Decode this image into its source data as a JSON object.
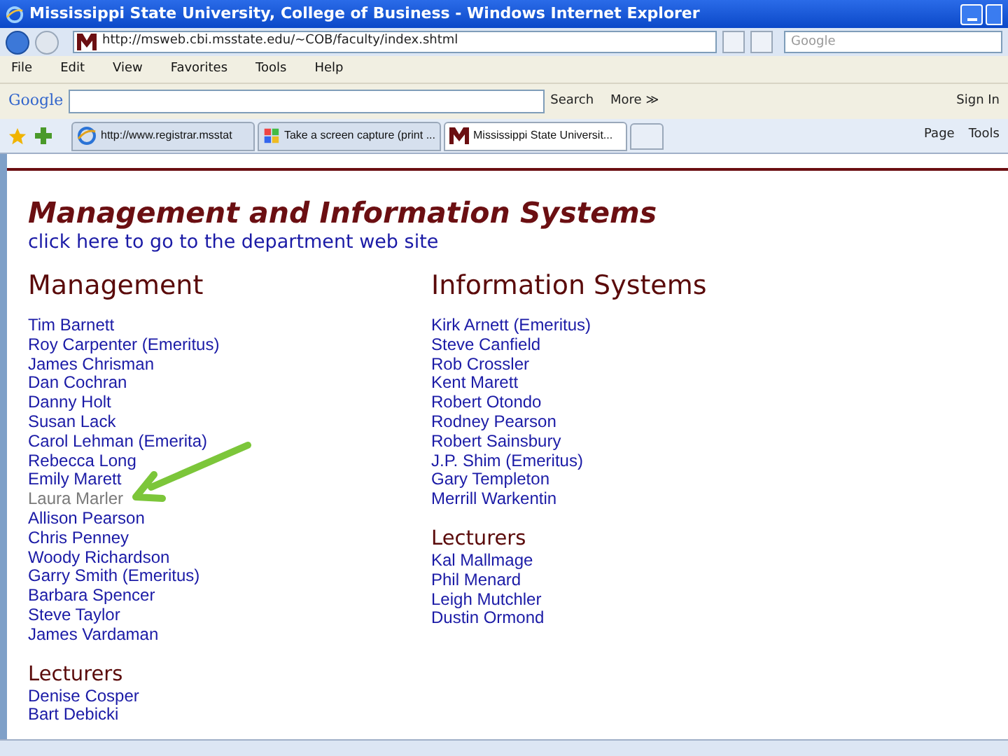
{
  "window": {
    "title": "Mississippi State University, College of Business - Windows Internet Explorer"
  },
  "address_bar": {
    "url": "http://msweb.cbi.msstate.edu/~COB/faculty/index.shtml",
    "search_placeholder": "Google"
  },
  "menu": [
    "File",
    "Edit",
    "View",
    "Favorites",
    "Tools",
    "Help"
  ],
  "google_toolbar": {
    "logo": "Google",
    "search_button": "Search",
    "more": "More ≫",
    "sign_in": "Sign In"
  },
  "tabs": [
    {
      "label": "http://www.registrar.msstat",
      "selected": false,
      "kind": "ie"
    },
    {
      "label": "Take a screen capture (print ...",
      "selected": false,
      "kind": "windows"
    },
    {
      "label": "Mississippi State Universit...",
      "selected": true,
      "kind": "msu"
    }
  ],
  "command_bar": {
    "page": "Page",
    "tools": "Tools"
  },
  "page": {
    "title": "Management and Information Systems",
    "link": "click here to go to the department web site",
    "columns": [
      {
        "heading": "Management",
        "people": [
          {
            "name": "Tim Barnett",
            "visited": false
          },
          {
            "name": "Roy Carpenter (Emeritus)",
            "visited": false
          },
          {
            "name": "James Chrisman",
            "visited": false
          },
          {
            "name": "Dan Cochran",
            "visited": false
          },
          {
            "name": "Danny Holt",
            "visited": false
          },
          {
            "name": "Susan Lack",
            "visited": false
          },
          {
            "name": "Carol Lehman (Emerita)",
            "visited": false
          },
          {
            "name": "Rebecca Long",
            "visited": false
          },
          {
            "name": "Emily Marett",
            "visited": false
          },
          {
            "name": "Laura Marler",
            "visited": true
          },
          {
            "name": "Allison Pearson",
            "visited": false
          },
          {
            "name": "Chris Penney",
            "visited": false
          },
          {
            "name": "Woody Richardson",
            "visited": false
          },
          {
            "name": "Garry Smith (Emeritus)",
            "visited": false
          },
          {
            "name": "Barbara Spencer",
            "visited": false
          },
          {
            "name": "Steve Taylor",
            "visited": false
          },
          {
            "name": "James Vardaman",
            "visited": false
          }
        ],
        "lecturers_heading": "Lecturers",
        "lecturers": [
          {
            "name": "Denise Cosper",
            "visited": false
          },
          {
            "name": "Bart Debicki",
            "visited": false
          }
        ]
      },
      {
        "heading": "Information Systems",
        "people": [
          {
            "name": "Kirk Arnett (Emeritus)",
            "visited": false
          },
          {
            "name": "Steve Canfield",
            "visited": false
          },
          {
            "name": "Rob Crossler",
            "visited": false
          },
          {
            "name": "Kent Marett",
            "visited": false
          },
          {
            "name": "Robert Otondo",
            "visited": false
          },
          {
            "name": "Rodney Pearson",
            "visited": false
          },
          {
            "name": "Robert Sainsbury",
            "visited": false
          },
          {
            "name": "J.P. Shim (Emeritus)",
            "visited": false
          },
          {
            "name": "Gary Templeton",
            "visited": false
          },
          {
            "name": "Merrill Warkentin",
            "visited": false
          }
        ],
        "lecturers_heading": "Lecturers",
        "lecturers": [
          {
            "name": "Kal Mallmage",
            "visited": false
          },
          {
            "name": "Phil Menard",
            "visited": false
          },
          {
            "name": "Leigh Mutchler",
            "visited": false
          },
          {
            "name": "Dustin Ormond",
            "visited": false
          }
        ]
      }
    ]
  }
}
